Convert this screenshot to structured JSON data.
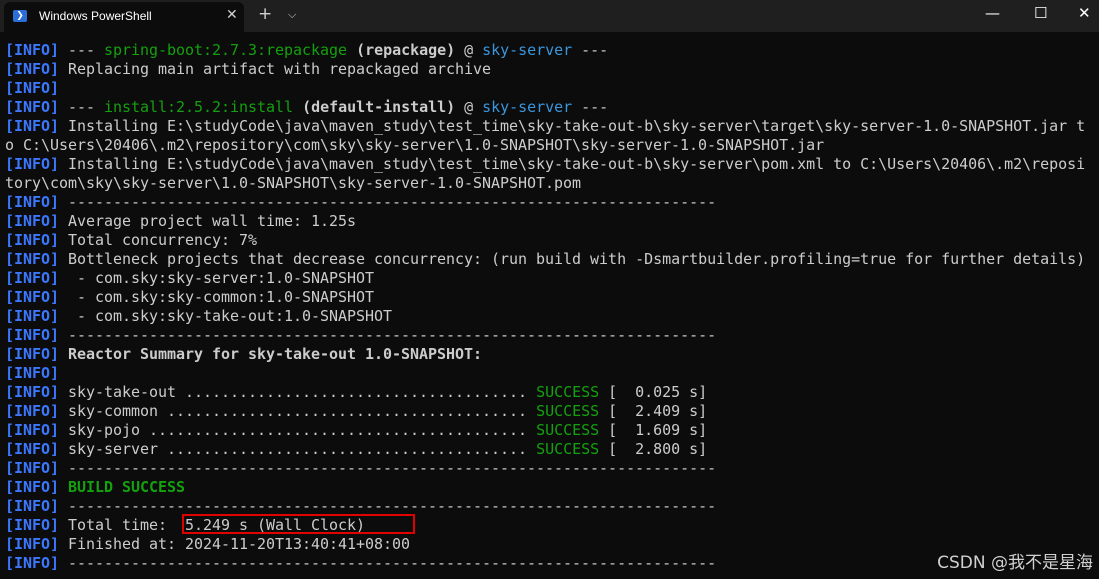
{
  "titlebar": {
    "tab_title": "Windows PowerShell",
    "tab_icon_glyph": "❯",
    "close_tab_glyph": "✕",
    "new_tab_glyph": "+",
    "dropdown_glyph": "⌵",
    "minimize_glyph": "—",
    "maximize_glyph": "☐",
    "close_window_glyph": "✕"
  },
  "terminal": {
    "tag": "[INFO]",
    "lines": [
      [
        {
          "t": "[INFO]",
          "c": "tag"
        },
        {
          "t": " --- "
        },
        {
          "t": "spring-boot:2.7.3:repackage",
          "c": "g"
        },
        {
          "t": " (repackage)",
          "c": "bold"
        },
        {
          "t": " @ "
        },
        {
          "t": "sky-server",
          "c": "b"
        },
        {
          "t": " ---"
        }
      ],
      [
        {
          "t": "[INFO]",
          "c": "tag"
        },
        {
          "t": " Replacing main artifact with repackaged archive"
        }
      ],
      [
        {
          "t": "[INFO]",
          "c": "tag"
        }
      ],
      [
        {
          "t": "[INFO]",
          "c": "tag"
        },
        {
          "t": " --- "
        },
        {
          "t": "install:2.5.2:install",
          "c": "g"
        },
        {
          "t": " (default-install)",
          "c": "bold"
        },
        {
          "t": " @ "
        },
        {
          "t": "sky-server",
          "c": "b"
        },
        {
          "t": " ---"
        }
      ],
      [
        {
          "t": "[INFO]",
          "c": "tag"
        },
        {
          "t": " Installing E:\\studyCode\\java\\maven_study\\test_time\\sky-take-out-b\\sky-server\\target\\sky-server-1.0-SNAPSHOT.jar t"
        }
      ],
      [
        {
          "t": "o C:\\Users\\20406\\.m2\\repository\\com\\sky\\sky-server\\1.0-SNAPSHOT\\sky-server-1.0-SNAPSHOT.jar"
        }
      ],
      [
        {
          "t": "[INFO]",
          "c": "tag"
        },
        {
          "t": " Installing E:\\studyCode\\java\\maven_study\\test_time\\sky-take-out-b\\sky-server\\pom.xml to C:\\Users\\20406\\.m2\\reposi"
        }
      ],
      [
        {
          "t": "tory\\com\\sky\\sky-server\\1.0-SNAPSHOT\\sky-server-1.0-SNAPSHOT.pom"
        }
      ],
      [
        {
          "t": "[INFO]",
          "c": "tag"
        },
        {
          "t": " ------------------------------------------------------------------------"
        }
      ],
      [
        {
          "t": "[INFO]",
          "c": "tag"
        },
        {
          "t": " Average project wall time: 1.25s"
        }
      ],
      [
        {
          "t": "[INFO]",
          "c": "tag"
        },
        {
          "t": " Total concurrency: 7%"
        }
      ],
      [
        {
          "t": "[INFO]",
          "c": "tag"
        },
        {
          "t": " Bottleneck projects that decrease concurrency: (run build with -Dsmartbuilder.profiling=true for further details)"
        }
      ],
      [
        {
          "t": "[INFO]",
          "c": "tag"
        },
        {
          "t": "  - com.sky:sky-server:1.0-SNAPSHOT"
        }
      ],
      [
        {
          "t": "[INFO]",
          "c": "tag"
        },
        {
          "t": "  - com.sky:sky-common:1.0-SNAPSHOT"
        }
      ],
      [
        {
          "t": "[INFO]",
          "c": "tag"
        },
        {
          "t": "  - com.sky:sky-take-out:1.0-SNAPSHOT"
        }
      ],
      [
        {
          "t": "[INFO]",
          "c": "tag"
        },
        {
          "t": " ------------------------------------------------------------------------"
        }
      ],
      [
        {
          "t": "[INFO]",
          "c": "tag"
        },
        {
          "t": " Reactor Summary for sky-take-out 1.0-SNAPSHOT:",
          "c": "bold"
        }
      ],
      [
        {
          "t": "[INFO]",
          "c": "tag"
        }
      ],
      [
        {
          "t": "[INFO]",
          "c": "tag"
        },
        {
          "t": " sky-take-out ...................................... "
        },
        {
          "t": "SUCCESS",
          "c": "g"
        },
        {
          "t": " [  0.025 s]"
        }
      ],
      [
        {
          "t": "[INFO]",
          "c": "tag"
        },
        {
          "t": " sky-common ........................................ "
        },
        {
          "t": "SUCCESS",
          "c": "g"
        },
        {
          "t": " [  2.409 s]"
        }
      ],
      [
        {
          "t": "[INFO]",
          "c": "tag"
        },
        {
          "t": " sky-pojo .......................................... "
        },
        {
          "t": "SUCCESS",
          "c": "g"
        },
        {
          "t": " [  1.609 s]"
        }
      ],
      [
        {
          "t": "[INFO]",
          "c": "tag"
        },
        {
          "t": " sky-server ........................................ "
        },
        {
          "t": "SUCCESS",
          "c": "g"
        },
        {
          "t": " [  2.800 s]"
        }
      ],
      [
        {
          "t": "[INFO]",
          "c": "tag"
        },
        {
          "t": " ------------------------------------------------------------------------"
        }
      ],
      [
        {
          "t": "[INFO]",
          "c": "tag"
        },
        {
          "t": " "
        },
        {
          "t": "BUILD SUCCESS",
          "c": "gbold"
        }
      ],
      [
        {
          "t": "[INFO]",
          "c": "tag"
        },
        {
          "t": " ------------------------------------------------------------------------"
        }
      ],
      [
        {
          "t": "[INFO]",
          "c": "tag"
        },
        {
          "t": " Total time:  5.249 s (Wall Clock)"
        }
      ],
      [
        {
          "t": "[INFO]",
          "c": "tag"
        },
        {
          "t": " Finished at: 2024-11-20T13:40:41+08:00"
        }
      ],
      [
        {
          "t": "[INFO]",
          "c": "tag"
        },
        {
          "t": " ------------------------------------------------------------------------"
        }
      ]
    ]
  },
  "colors": {
    "background": "#0c0c0c",
    "text": "#cccccc",
    "info_tag": "#3b78ff",
    "plugin_green": "#13a10e",
    "artifact_blue": "#3a96dd",
    "highlight_red": "#e00000"
  },
  "watermark": "CSDN @我不是星海"
}
